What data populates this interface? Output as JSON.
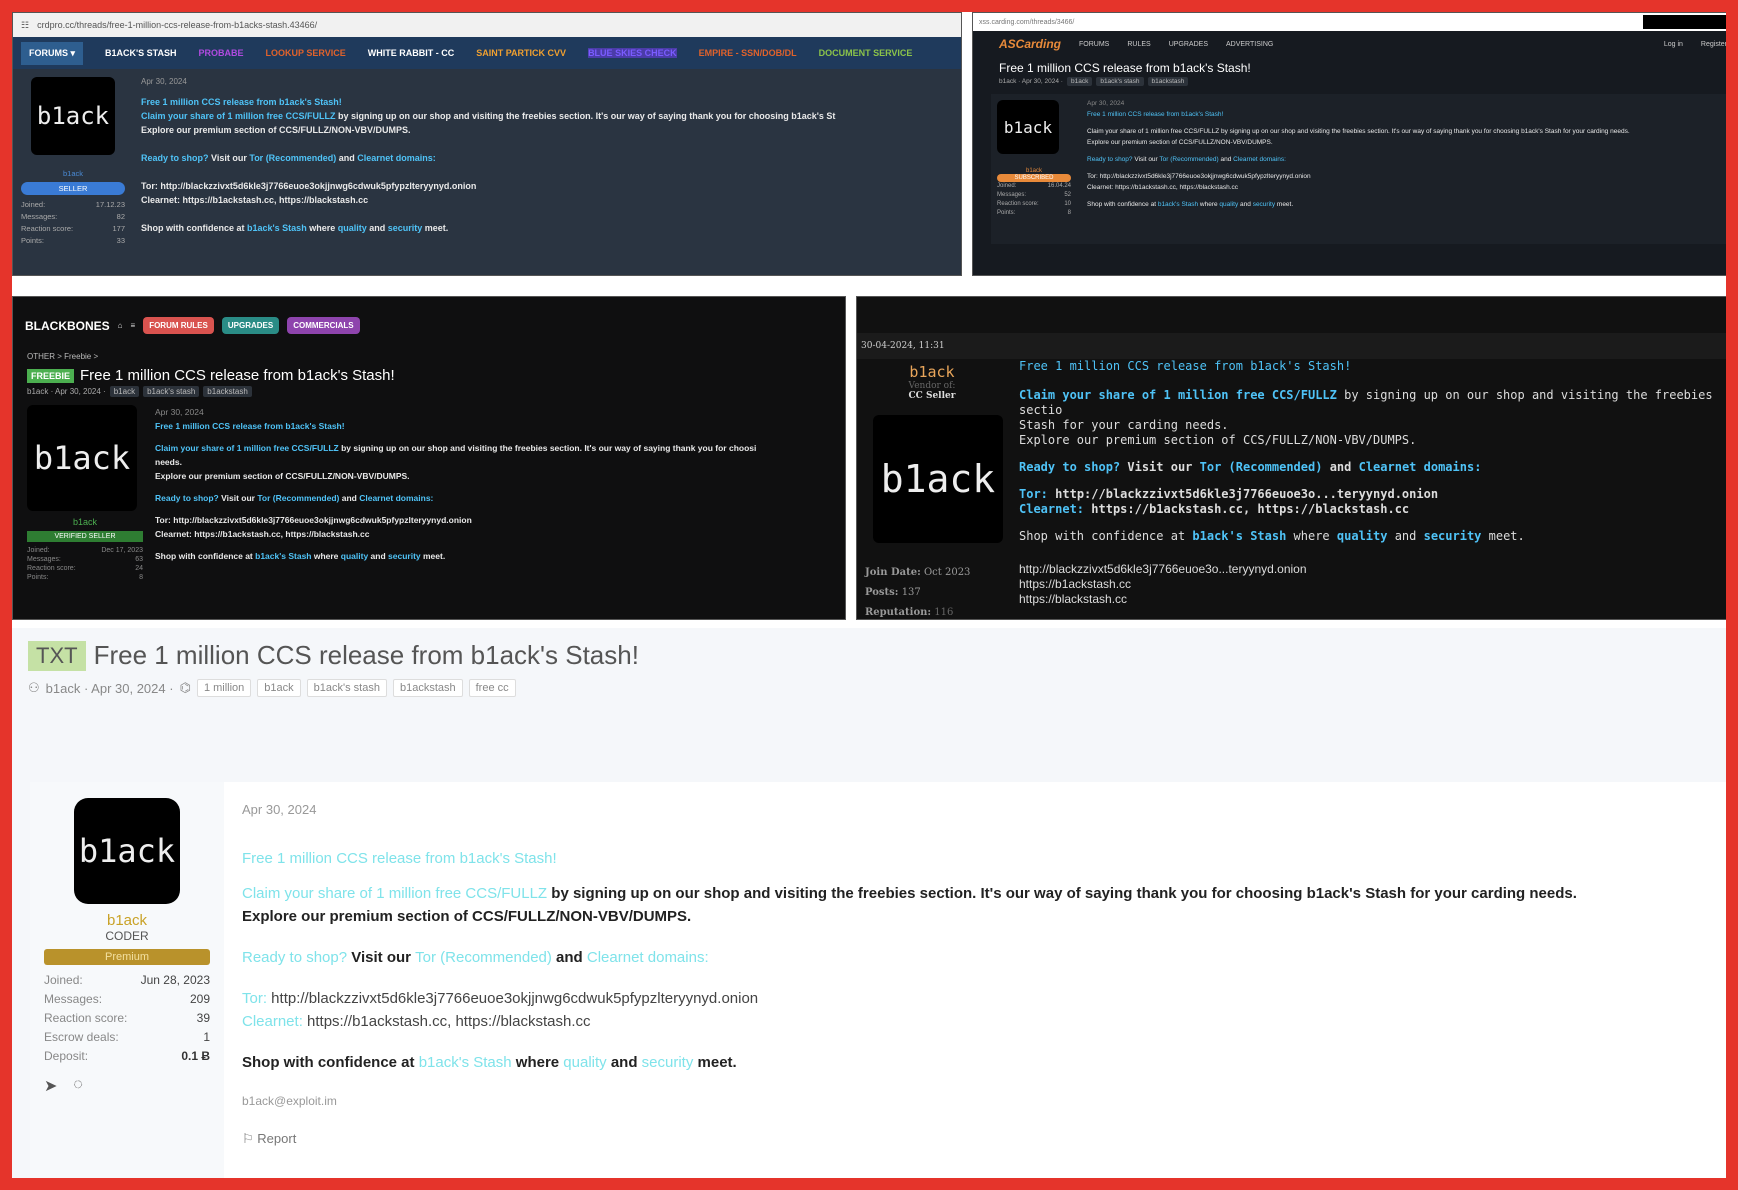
{
  "p1": {
    "url": "crdpro.cc/threads/free-1-million-ccs-release-from-b1acks-stash.43466/",
    "nav": [
      "FORUMS",
      "B1ACK'S STASH",
      "PROBABE",
      "LOOKUP SERVICE",
      "WHITE RABBIT - CC",
      "SAINT PARTICK CVV",
      "BLUE SKIES CHECK",
      "EMPIRE - SSN/DOB/DL",
      "DOCUMENT SERVICE"
    ],
    "date": "Apr 30, 2024",
    "avatar": "b1ack",
    "user": "b1ack",
    "badge": "SELLER",
    "stats": [
      [
        "Joined:",
        "17.12.23"
      ],
      [
        "Messages:",
        "82"
      ],
      [
        "Reaction score:",
        "177"
      ],
      [
        "Points:",
        "33"
      ]
    ],
    "l1": "Free 1 million CCS release from b1ack's Stash!",
    "l2a": "Claim your share of 1 million free CCS/FULLZ",
    "l2b": " by signing up on our shop and visiting the freebies section. It's our way of saying thank you for choosing b1ack's St",
    "l3": "Explore our premium section of CCS/FULLZ/NON-VBV/DUMPS.",
    "l4a": "Ready to shop?",
    "l4b": " Visit our ",
    "l4c": "Tor (Recommended)",
    "l4d": " and ",
    "l4e": "Clearnet domains:",
    "tor": "Tor: http://blackzzivxt5d6kle3j7766euoe3okjjnwg6cdwuk5pfypzlteryynyd.onion",
    "clear": "Clearnet: https://b1ackstash.cc, https://blackstash.cc",
    "l7a": "Shop with confidence at ",
    "l7b": "b1ack's Stash",
    "l7c": " where ",
    "l7d": "quality",
    "l7e": " and ",
    "l7f": "security",
    "l7g": " meet."
  },
  "p2": {
    "url": "xss.carding.com/threads/3466/",
    "logo": "ASCarding",
    "nav": [
      "FORUMS",
      "RULES",
      "UPGRADES",
      "ADVERTISING"
    ],
    "login": "Log in",
    "register": "Register",
    "title": "Free 1 million CCS release from b1ack's Stash!",
    "meta": "b1ack · Apr 30, 2024 ·",
    "tags": [
      "b1ack",
      "b1ack's stash",
      "b1ackstash"
    ],
    "date": "Apr 30, 2024",
    "user": "b1ack",
    "badge": "SUBSCRIBED",
    "stats": [
      [
        "Joined:",
        "16.04.24"
      ],
      [
        "Messages:",
        "52"
      ],
      [
        "Reaction score:",
        "10"
      ],
      [
        "Points:",
        "8"
      ]
    ],
    "l2": "Claim your share of 1 million free CCS/FULLZ by signing up on our shop and visiting the freebies section. It's our way of saying thank you for choosing b1ack's Stash for your carding needs.",
    "tor": "Tor: http://blackzzivxt5d6kle3j7766euoe3okjjnwg6cdwuk5pfypzlteryynyd.onion"
  },
  "p3": {
    "logo": "BLACKBONES",
    "pills": [
      "FORUM RULES",
      "UPGRADES",
      "COMMERCIALS"
    ],
    "crumb": "OTHER  >  Freebie  >",
    "prefix": "FREEBIE",
    "title": "Free 1 million CCS release from b1ack's Stash!",
    "meta": "b1ack · Apr 30, 2024 ·",
    "tags": [
      "b1ack",
      "b1ack's stash",
      "b1ackstash"
    ],
    "date": "Apr 30, 2024",
    "badge": "VERIFIED SELLER",
    "stats": [
      [
        "Joined:",
        "Dec 17, 2023"
      ],
      [
        "Messages:",
        "63"
      ],
      [
        "Reaction score:",
        "24"
      ],
      [
        "Points:",
        "8"
      ]
    ],
    "l2b": " by signing up on our shop and visiting the freebies section. It's our way of saying thank you for choosi",
    "l2c": "needs."
  },
  "p4": {
    "date": "30-04-2024, 11:31",
    "user": "b1ack",
    "vendor": "Vendor of:",
    "vendor2": "CC Seller",
    "join": "Join Date:",
    "joinv": "Oct 2023",
    "posts": "Posts:",
    "postsv": "137",
    "rep": "Reputation:",
    "repv": "116",
    "l2b": " by signing up on our shop and visiting the freebies sectio",
    "l2c": "Stash for your carding needs.",
    "torv": "http://blackzzivxt5d6kle3j7766euoe3o...teryynyd.onion",
    "clearv": "https://b1ackstash.cc, https://blackstash.cc",
    "x1": "http://blackzzivxt5d6kle3j7766euoe3o...teryynyd.onion",
    "x2": "https://b1ackstash.cc",
    "x3": "https://blackstash.cc"
  },
  "p5": {
    "badge": "TXT",
    "title": "Free 1 million CCS release from b1ack's Stash!",
    "meta": "b1ack · Apr 30, 2024 ·",
    "tags": [
      "1 million",
      "b1ack",
      "b1ack's stash",
      "b1ackstash",
      "free cc"
    ],
    "date": "Apr 30, 2024",
    "user": "b1ack",
    "role": "CODER",
    "badge2": "Premium",
    "stats": [
      [
        "Joined:",
        "Jun 28, 2023"
      ],
      [
        "Messages:",
        "209"
      ],
      [
        "Reaction score:",
        "39"
      ],
      [
        "Escrow deals:",
        "1"
      ],
      [
        "Deposit:",
        "0.1 Ƀ"
      ]
    ],
    "l2b": " by signing up on our shop and visiting the freebies section. It's our way of saying thank you for choosing b1ack's Stash for your carding needs.",
    "torlabel": "Tor:",
    "torv": " http://blackzzivxt5d6kle3j7766euoe3okjjnwg6cdwuk5pfypzlteryynyd.onion",
    "clearlabel": "Clearnet:",
    "clearv": " https://b1ackstash.cc, https://blackstash.cc",
    "sig": "b1ack@exploit.im",
    "report": "Report"
  }
}
